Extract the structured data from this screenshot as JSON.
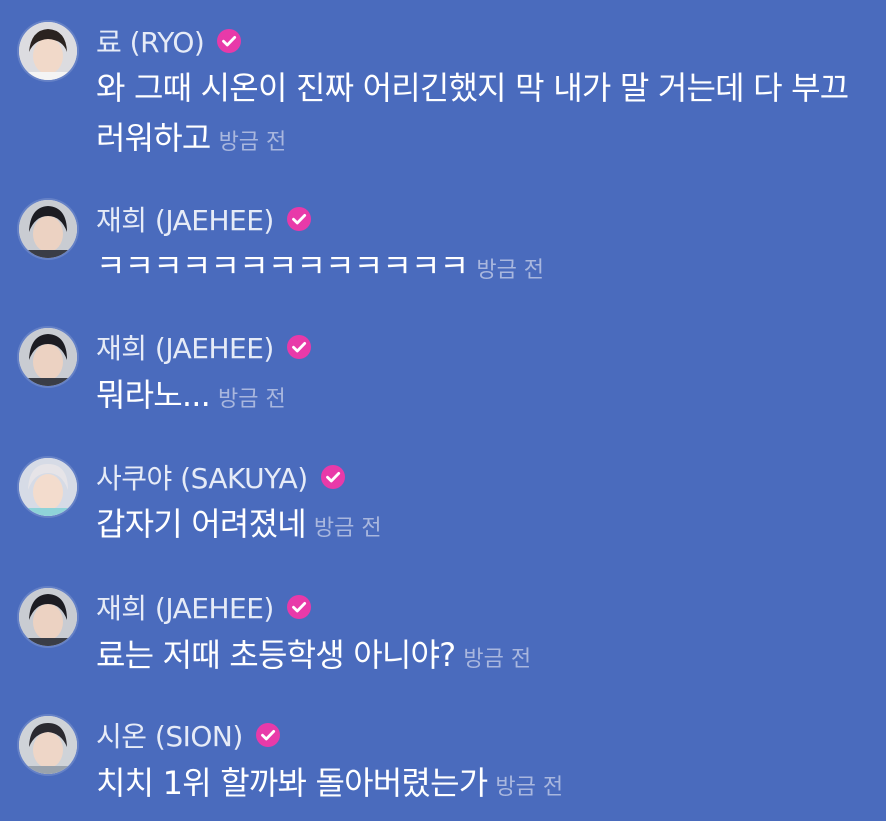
{
  "colors": {
    "background": "#4a6bbd",
    "name": "#e6ebf7",
    "message": "#ffffff",
    "timestamp": "#a9b7de",
    "verified_badge": "#e83aa9"
  },
  "messages": [
    {
      "name": "료 (RYO)",
      "verified_icon": "verified-check-icon",
      "text": "와 그때 시온이 진짜 어리긴했지 막 내가 말 거는데 다 부끄러워하고",
      "time": "방금 전"
    },
    {
      "name": "재희 (JAEHEE)",
      "verified_icon": "verified-check-icon",
      "text": "ㅋㅋㅋㅋㅋㅋㅋㅋㅋㅋㅋㅋㅋ",
      "time": "방금 전"
    },
    {
      "name": "재희 (JAEHEE)",
      "verified_icon": "verified-check-icon",
      "text": "뭐라노...",
      "time": "방금 전"
    },
    {
      "name": "사쿠야 (SAKUYA)",
      "verified_icon": "verified-check-icon",
      "text": "갑자기 어려졌네",
      "time": "방금 전"
    },
    {
      "name": "재희 (JAEHEE)",
      "verified_icon": "verified-check-icon",
      "text": "료는 저때 초등학생 아니야?",
      "time": "방금 전"
    },
    {
      "name": "시온 (SION)",
      "verified_icon": "verified-check-icon",
      "text": "치치 1위 할까봐 돌아버렸는가",
      "time": "방금 전"
    }
  ]
}
